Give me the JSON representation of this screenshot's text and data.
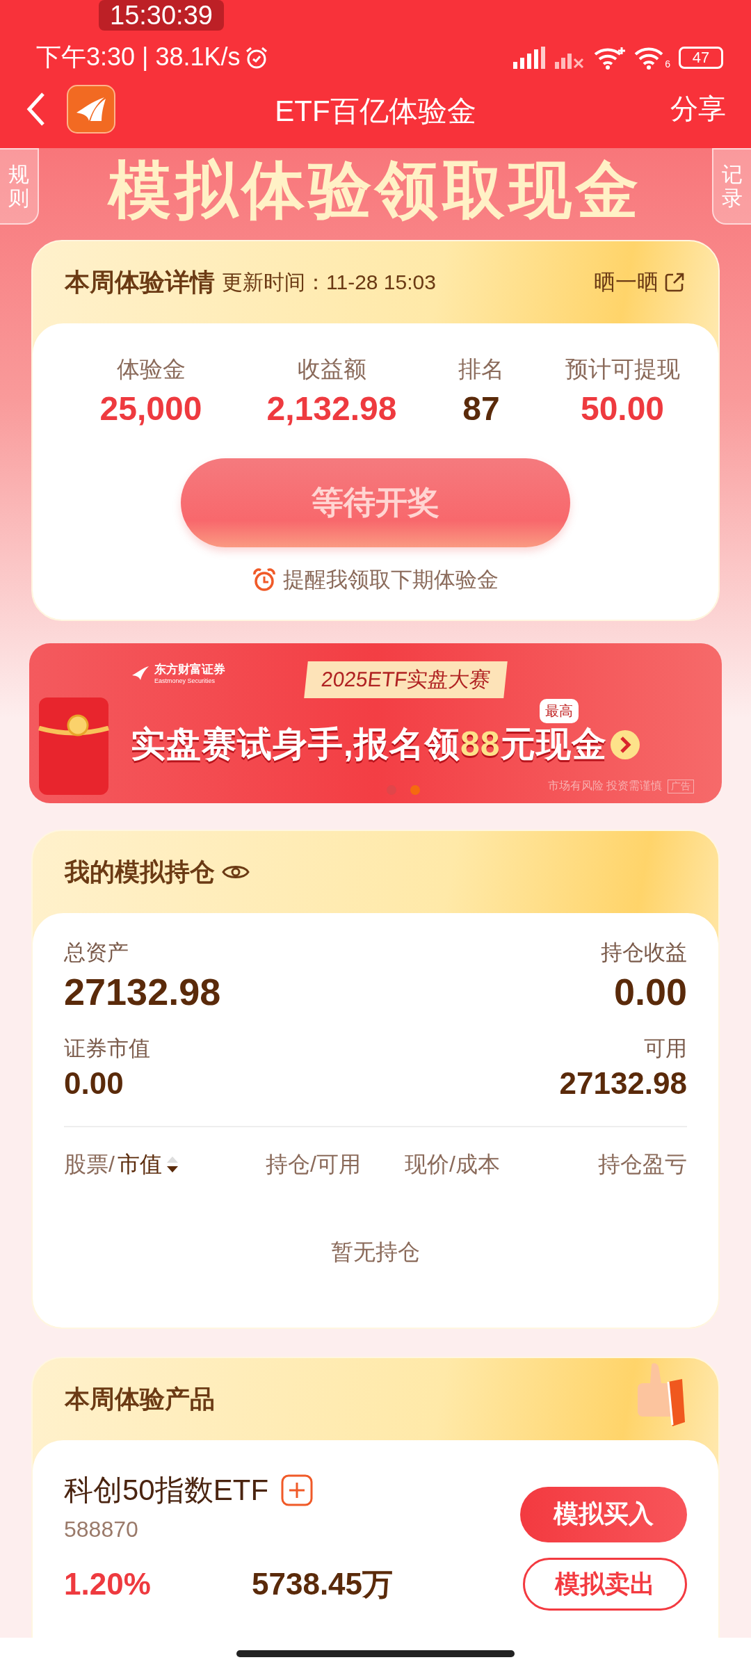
{
  "status_bar": {
    "time_speed": "下午3:30 | 38.1K/s",
    "clock_overlay": "15:30:39",
    "wifi_standard": "6",
    "battery": "47"
  },
  "nav": {
    "title": "ETF百亿体验金",
    "action": "分享"
  },
  "hero": {
    "title": "模拟体验领取现金",
    "left_tab": "规则",
    "right_tab": "记录"
  },
  "weekly_card": {
    "title": "本周体验详情",
    "updated": "更新时间：11-28 15:03",
    "share": "晒一晒",
    "stats": [
      {
        "label": "体验金",
        "value": "25,000",
        "kind": "money"
      },
      {
        "label": "收益额",
        "value": "2,132.98",
        "kind": "money"
      },
      {
        "label": "排名",
        "value": "87",
        "kind": "rank"
      },
      {
        "label": "预计可提现",
        "value": "50.00",
        "kind": "money"
      }
    ],
    "button": "等待开奖",
    "reminder": "提醒我领取下期体验金"
  },
  "ad": {
    "brand": "东方财富证券",
    "brand_en": "Eastmoney Securities",
    "tag": "2025ETF实盘大赛",
    "badge": "最高",
    "headline_start": "实盘赛试身手,报名领",
    "headline_amount": "88",
    "headline_end": "元现金",
    "risk": "市场有风险 投资需谨慎",
    "ad_label": "广告",
    "dots": [
      {
        "selected": false
      },
      {
        "selected": true
      }
    ]
  },
  "holdings": {
    "title": "我的模拟持仓",
    "summary": [
      {
        "label": "总资产",
        "value": "27132.98"
      },
      {
        "label": "持仓收益",
        "value": "0.00"
      },
      {
        "label": "证券市值",
        "value": "0.00"
      },
      {
        "label": "可用",
        "value": "27132.98"
      }
    ],
    "columns": [
      {
        "label": "股票/",
        "sort_label": "市值",
        "sorted": true
      },
      {
        "label": "持仓/可用"
      },
      {
        "label": "现价/成本"
      },
      {
        "label": "持仓盈亏"
      }
    ],
    "empty": "暂无持仓"
  },
  "product": {
    "title": "本周体验产品",
    "name": "科创50指数ETF",
    "code": "588870",
    "buy": "模拟买入",
    "sell": "模拟卖出",
    "change": "1.20%",
    "volume": "5738.45万"
  }
}
